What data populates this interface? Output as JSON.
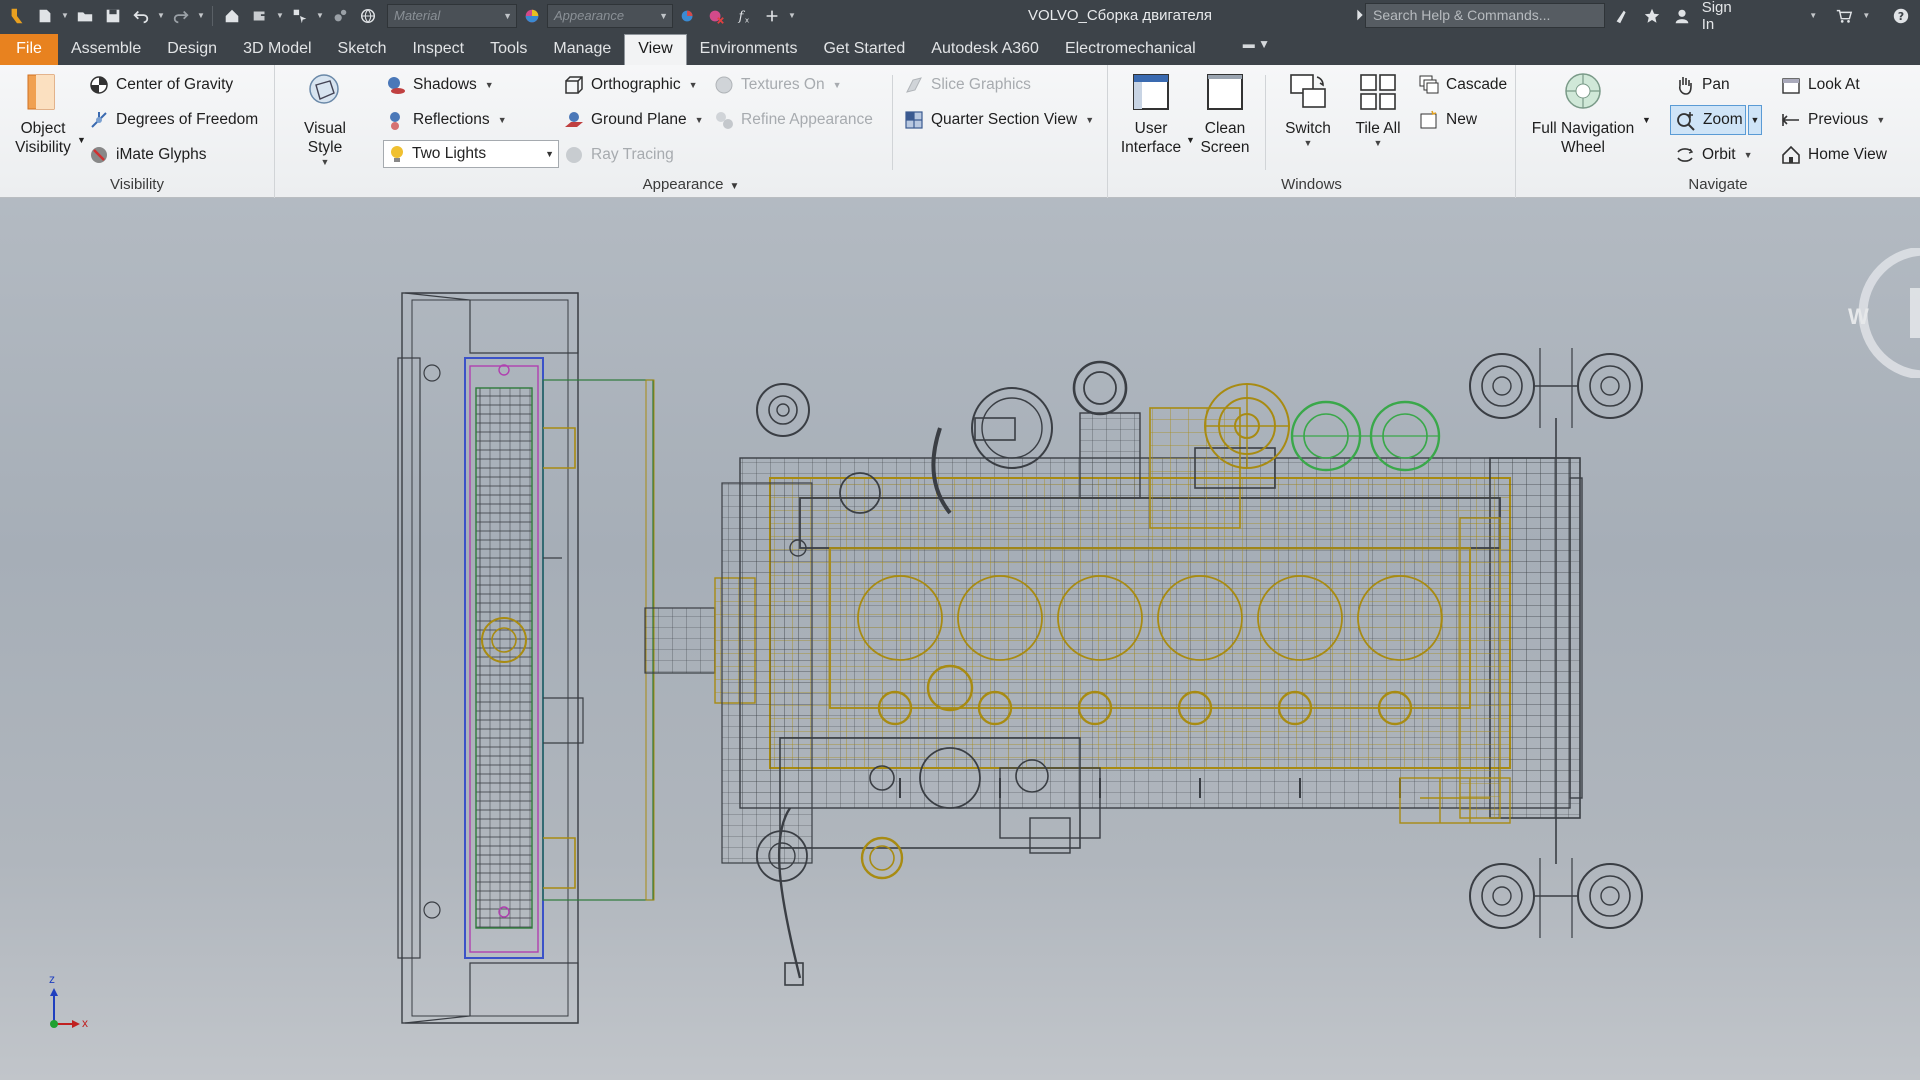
{
  "titlebar": {
    "document_title": "VOLVO_Сборка двигателя",
    "material_placeholder": "Material",
    "appearance_placeholder": "Appearance",
    "search_placeholder": "Search Help & Commands...",
    "sign_in": "Sign In"
  },
  "tabs": [
    {
      "label": "File"
    },
    {
      "label": "Assemble"
    },
    {
      "label": "Design"
    },
    {
      "label": "3D Model"
    },
    {
      "label": "Sketch"
    },
    {
      "label": "Inspect"
    },
    {
      "label": "Tools"
    },
    {
      "label": "Manage"
    },
    {
      "label": "View",
      "active": true
    },
    {
      "label": "Environments"
    },
    {
      "label": "Get Started"
    },
    {
      "label": "Autodesk A360"
    },
    {
      "label": "Electromechanical"
    }
  ],
  "ribbon": {
    "visibility": {
      "title": "Visibility",
      "object_visibility_line1": "Object",
      "object_visibility_line2": "Visibility",
      "center_of_gravity": "Center of Gravity",
      "degrees_of_freedom": "Degrees of Freedom",
      "imate_glyphs": "iMate Glyphs"
    },
    "appearance": {
      "title": "Appearance",
      "visual_style": "Visual Style",
      "shadows": "Shadows",
      "reflections": "Reflections",
      "lighting_style": "Two Lights",
      "orthographic": "Orthographic",
      "ground_plane": "Ground Plane",
      "textures_on": "Textures On",
      "refine_appearance": "Refine Appearance",
      "ray_tracing": "Ray Tracing",
      "slice_graphics": "Slice Graphics",
      "quarter_section_view": "Quarter Section View"
    },
    "windows": {
      "title": "Windows",
      "user_interface_line1": "User",
      "user_interface_line2": "Interface",
      "clean_screen_line1": "Clean",
      "clean_screen_line2": "Screen",
      "switch": "Switch",
      "tile_all": "Tile All",
      "cascade": "Cascade",
      "new": "New"
    },
    "navigate": {
      "title": "Navigate",
      "full_nav_wheel_line1": "Full Navigation",
      "full_nav_wheel_line2": "Wheel",
      "pan": "Pan",
      "zoom": "Zoom",
      "orbit": "Orbit",
      "look_at": "Look At",
      "previous": "Previous",
      "home_view": "Home View"
    }
  },
  "viewport": {
    "viewcube_face": "W",
    "axis_z": "z",
    "axis_x": "x"
  },
  "colors": {
    "file_tab": "#e8821f",
    "wire_dark": "#3a3e44",
    "wire_gold": "#a88b12",
    "wire_green": "#3aa84a",
    "wire_blue": "#3b52c8",
    "wire_magenta": "#b040b0"
  }
}
